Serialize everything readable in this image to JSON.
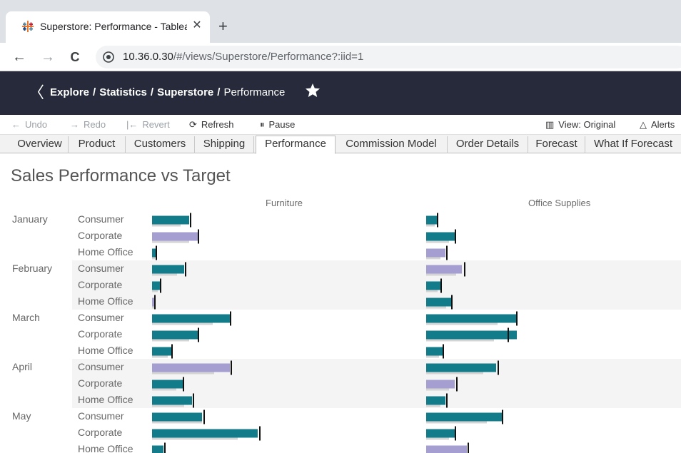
{
  "browser": {
    "tab_title": "Superstore: Performance - Tableau",
    "close_glyph": "✕",
    "new_tab_glyph": "+",
    "back_glyph": "←",
    "forward_glyph": "→",
    "reload_glyph": "C",
    "url_host": "10.36.0.30",
    "url_path": "/#/views/Superstore/Performance?:iid=1"
  },
  "header": {
    "back_glyph": "〈",
    "crumbs": [
      "Explore",
      "Statistics",
      "Superstore",
      "Performance"
    ],
    "separator": "/"
  },
  "toolbar": {
    "undo": "Undo",
    "redo": "Redo",
    "revert": "Revert",
    "refresh": "Refresh",
    "pause": "Pause",
    "view": "View: Original",
    "alerts": "Alerts"
  },
  "sheet_tabs": [
    "Overview",
    "Product",
    "Customers",
    "Shipping",
    "Performance",
    "Commission Model",
    "Order Details",
    "Forecast",
    "What If Forecast"
  ],
  "active_tab": "Performance",
  "viz": {
    "title": "Sales Performance vs Target",
    "pane_labels": [
      "Furniture",
      "Office Supplies"
    ]
  },
  "colors": {
    "above_target": "#137c8b",
    "below_target": "#a59fd1",
    "prior_bar": "#d4d4d4",
    "target_mark": "#111111",
    "header_bg": "#262a3a"
  },
  "chart_data": {
    "type": "bar",
    "title": "Sales Performance vs Target",
    "panes": [
      "Furniture",
      "Office Supplies"
    ],
    "months": [
      "January",
      "February",
      "March",
      "April",
      "May"
    ],
    "segments": [
      "Consumer",
      "Corporate",
      "Home Office"
    ],
    "rows": [
      {
        "month": "January",
        "segment": "Consumer",
        "furniture": {
          "sales": 52,
          "target": 53,
          "prior": 40,
          "met": true
        },
        "office": {
          "sales": 15,
          "target": 15,
          "prior": 12,
          "met": true
        }
      },
      {
        "month": "January",
        "segment": "Corporate",
        "furniture": {
          "sales": 64,
          "target": 64,
          "prior": 52,
          "met": false
        },
        "office": {
          "sales": 40,
          "target": 40,
          "prior": 32,
          "met": true
        }
      },
      {
        "month": "January",
        "segment": "Home Office",
        "furniture": {
          "sales": 5,
          "target": 5,
          "prior": 4,
          "met": true
        },
        "office": {
          "sales": 27,
          "target": 28,
          "prior": 20,
          "met": false
        }
      },
      {
        "month": "February",
        "segment": "Consumer",
        "furniture": {
          "sales": 45,
          "target": 46,
          "prior": 35,
          "met": true
        },
        "office": {
          "sales": 50,
          "target": 53,
          "prior": 42,
          "met": false
        }
      },
      {
        "month": "February",
        "segment": "Corporate",
        "furniture": {
          "sales": 11,
          "target": 11,
          "prior": 8,
          "met": true
        },
        "office": {
          "sales": 20,
          "target": 20,
          "prior": 16,
          "met": true
        }
      },
      {
        "month": "February",
        "segment": "Home Office",
        "furniture": {
          "sales": 3,
          "target": 3,
          "prior": 3,
          "met": false
        },
        "office": {
          "sales": 35,
          "target": 35,
          "prior": 28,
          "met": true
        }
      },
      {
        "month": "March",
        "segment": "Consumer",
        "furniture": {
          "sales": 109,
          "target": 109,
          "prior": 85,
          "met": true
        },
        "office": {
          "sales": 128,
          "target": 126,
          "prior": 100,
          "met": true
        }
      },
      {
        "month": "March",
        "segment": "Corporate",
        "furniture": {
          "sales": 64,
          "target": 64,
          "prior": 52,
          "met": true
        },
        "office": {
          "sales": 127,
          "target": 114,
          "prior": 95,
          "met": true
        }
      },
      {
        "month": "March",
        "segment": "Home Office",
        "furniture": {
          "sales": 27,
          "target": 27,
          "prior": 22,
          "met": true
        },
        "office": {
          "sales": 23,
          "target": 23,
          "prior": 18,
          "met": true
        }
      },
      {
        "month": "April",
        "segment": "Consumer",
        "furniture": {
          "sales": 109,
          "target": 110,
          "prior": 87,
          "met": false
        },
        "office": {
          "sales": 98,
          "target": 100,
          "prior": 80,
          "met": true
        }
      },
      {
        "month": "April",
        "segment": "Corporate",
        "furniture": {
          "sales": 43,
          "target": 43,
          "prior": 34,
          "met": true
        },
        "office": {
          "sales": 40,
          "target": 42,
          "prior": 32,
          "met": false
        }
      },
      {
        "month": "April",
        "segment": "Home Office",
        "furniture": {
          "sales": 56,
          "target": 57,
          "prior": 45,
          "met": true
        },
        "office": {
          "sales": 27,
          "target": 28,
          "prior": 20,
          "met": true
        }
      },
      {
        "month": "May",
        "segment": "Consumer",
        "furniture": {
          "sales": 70,
          "target": 72,
          "prior": 70,
          "met": true
        },
        "office": {
          "sales": 108,
          "target": 106,
          "prior": 85,
          "met": true
        }
      },
      {
        "month": "May",
        "segment": "Corporate",
        "furniture": {
          "sales": 148,
          "target": 150,
          "prior": 120,
          "met": true
        },
        "office": {
          "sales": 40,
          "target": 40,
          "prior": 32,
          "met": true
        }
      },
      {
        "month": "May",
        "segment": "Home Office",
        "furniture": {
          "sales": 16,
          "target": 17,
          "prior": 13,
          "met": true
        },
        "office": {
          "sales": 57,
          "target": 58,
          "prior": 45,
          "met": false
        }
      }
    ]
  }
}
